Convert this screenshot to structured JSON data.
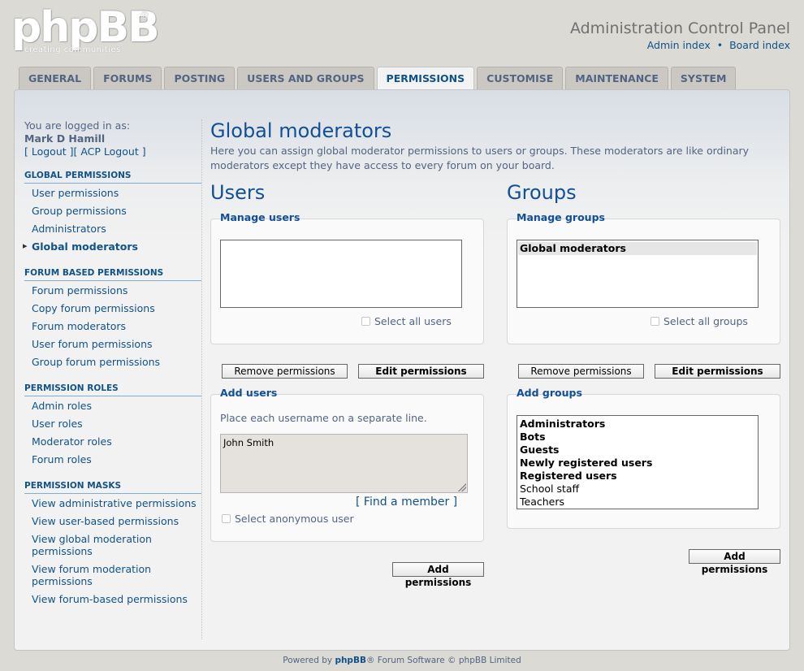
{
  "header": {
    "logo_text": "phpBB",
    "logo_reg": "®",
    "logo_tagline": "creating communities",
    "title": "Administration Control Panel",
    "links": [
      "Admin index",
      "Board index"
    ],
    "link_separator": "•"
  },
  "tabs": [
    {
      "label": "GENERAL",
      "active": false
    },
    {
      "label": "FORUMS",
      "active": false
    },
    {
      "label": "POSTING",
      "active": false
    },
    {
      "label": "USERS AND GROUPS",
      "active": false
    },
    {
      "label": "PERMISSIONS",
      "active": true
    },
    {
      "label": "CUSTOMISE",
      "active": false
    },
    {
      "label": "MAINTENANCE",
      "active": false
    },
    {
      "label": "SYSTEM",
      "active": false
    }
  ],
  "sidebar": {
    "logged_in_label": "You are logged in as:",
    "username": "Mark D Hamill",
    "logout_links": "[ Logout ][ ACP Logout ]",
    "sections": [
      {
        "title": "GLOBAL PERMISSIONS",
        "items": [
          "User permissions",
          "Group permissions",
          "Administrators",
          "Global moderators"
        ],
        "active_index": 3
      },
      {
        "title": "FORUM BASED PERMISSIONS",
        "items": [
          "Forum permissions",
          "Copy forum permissions",
          "Forum moderators",
          "User forum permissions",
          "Group forum permissions"
        ]
      },
      {
        "title": "PERMISSION ROLES",
        "items": [
          "Admin roles",
          "User roles",
          "Moderator roles",
          "Forum roles"
        ]
      },
      {
        "title": "PERMISSION MASKS",
        "items": [
          "View administrative permissions",
          "View user-based permissions",
          "View global moderation permissions",
          "View forum moderation permissions",
          "View forum-based permissions"
        ]
      }
    ]
  },
  "main": {
    "title": "Global moderators",
    "description": "Here you can assign global moderator permissions to users or groups. These moderators are like ordinary moderators except they have access to every forum on your board.",
    "users": {
      "heading": "Users",
      "manage_legend": "Manage users",
      "select_all_label": "Select all users",
      "remove_button": "Remove permissions",
      "edit_button": "Edit permissions",
      "add_legend": "Add users",
      "add_hint": "Place each username on a separate line.",
      "textarea_value": "John Smith",
      "find_member": "[ Find a member ]",
      "anonymous_label": "Select anonymous user",
      "add_button": "Add permissions"
    },
    "groups": {
      "heading": "Groups",
      "manage_legend": "Manage groups",
      "manage_options": [
        "Global moderators"
      ],
      "select_all_label": "Select all groups",
      "remove_button": "Remove permissions",
      "edit_button": "Edit permissions",
      "add_legend": "Add groups",
      "add_options": [
        {
          "label": "Administrators",
          "bold": true
        },
        {
          "label": "Bots",
          "bold": true
        },
        {
          "label": "Guests",
          "bold": true
        },
        {
          "label": "Newly registered users",
          "bold": true
        },
        {
          "label": "Registered users",
          "bold": true
        },
        {
          "label": "School staff",
          "bold": false
        },
        {
          "label": "Teachers",
          "bold": false
        }
      ],
      "add_button": "Add permissions"
    }
  },
  "footer": {
    "prefix": "Powered by ",
    "brand": "phpBB",
    "suffix": "® Forum Software © phpBB Limited"
  }
}
